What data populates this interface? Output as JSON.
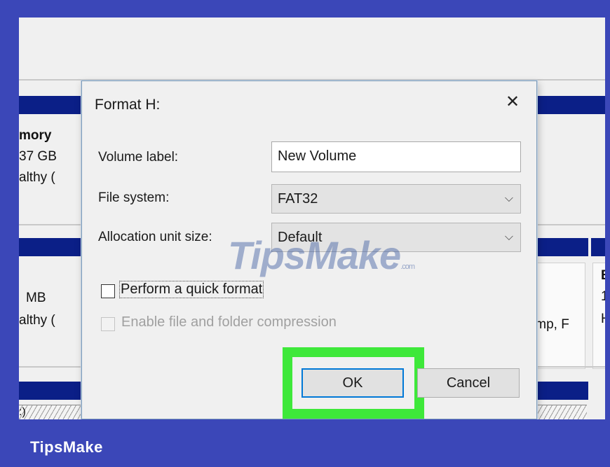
{
  "dialog": {
    "title": "Format H:",
    "close_glyph": "✕",
    "volume_label": {
      "label": "Volume label:",
      "value": "New Volume"
    },
    "file_system": {
      "label": "File system:",
      "value": "FAT32"
    },
    "allocation": {
      "label": "Allocation unit size:",
      "value": "Default"
    },
    "quick_format": {
      "label": "Perform a quick format",
      "checked": false
    },
    "compression": {
      "label": "Enable file and folder compression",
      "enabled": false
    },
    "ok_label": "OK",
    "cancel_label": "Cancel"
  },
  "background": {
    "disk_a": {
      "name": "mory",
      "size": "37 GB",
      "status": "althy ("
    },
    "disk_b": {
      "size": "MB",
      "status": "althy ("
    },
    "partition_c": {
      "text": "Dump, F"
    },
    "edge_e": {
      "line1": "E",
      "line2": "1",
      "line3": "H"
    },
    "bottom_label": ":)"
  },
  "watermark": {
    "text": "TipsMake",
    "suffix": ".com"
  },
  "brand": "TipsMake",
  "colors": {
    "frame": "#3b47b8",
    "disk_bar": "#0b1f87",
    "highlight": "#3ee83a",
    "ok_border": "#0078d7"
  }
}
